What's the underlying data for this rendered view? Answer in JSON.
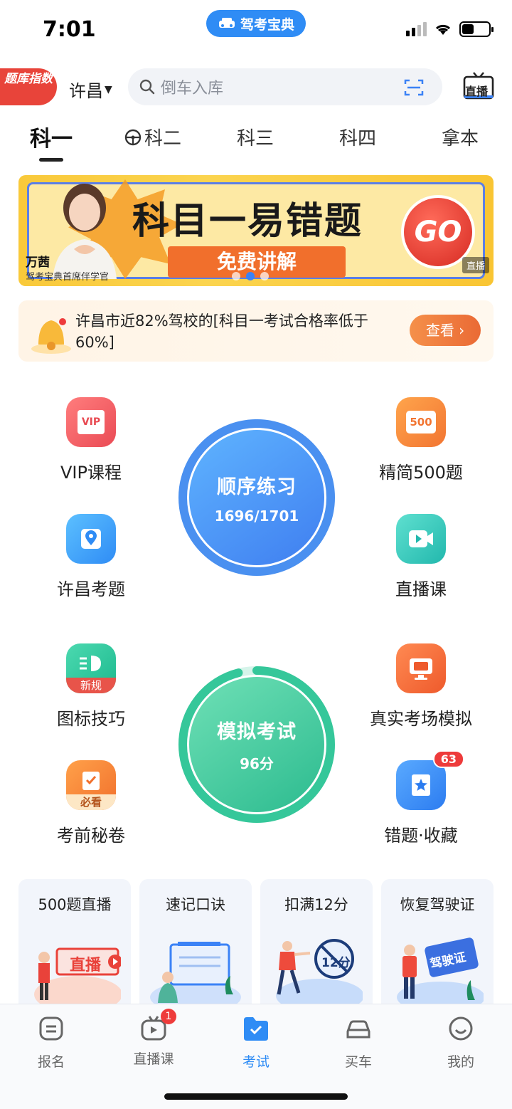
{
  "status_bar": {
    "time": "7:01",
    "app_name": "驾考宝典"
  },
  "header": {
    "index_badge": "题库指数",
    "city": "许昌",
    "search_placeholder": "倒车入库",
    "live_label": "直播"
  },
  "tabs": [
    {
      "label": "科一",
      "active": true
    },
    {
      "label": "科二",
      "active": false
    },
    {
      "label": "科三",
      "active": false
    },
    {
      "label": "科四",
      "active": false
    },
    {
      "label": "拿本",
      "active": false
    }
  ],
  "banner": {
    "title": "科目一易错题",
    "pill": "免费讲解",
    "go": "GO",
    "presenter_name": "万茜",
    "presenter_title": "驾考宝典首席伴学官",
    "tag": "直播",
    "active_dot": 2
  },
  "notice": {
    "text": "许昌市近82%驾校的[科目一考试合格率低于60%]",
    "button": "查看 ›"
  },
  "features": {
    "vip": "VIP课程",
    "jingjian": "精简500题",
    "xuchang": "许昌考题",
    "zhibo": "直播课",
    "tubiao": "图标技巧",
    "tubiao_badge": "新规",
    "zhenshi": "真实考场模拟",
    "miju": "考前秘卷",
    "miju_badge": "必看",
    "cuoti": "错题·收藏",
    "cuoti_count": "63",
    "vip_icon_text": "VIP",
    "jingjian_icon_text": "500"
  },
  "practice": {
    "title": "顺序练习",
    "progress_text": "1696/1701",
    "progress": 0.997
  },
  "exam": {
    "title": "模拟考试",
    "score_text": "96分",
    "score": 96
  },
  "cards": [
    {
      "title": "500题直播",
      "art_text": "直播"
    },
    {
      "title": "速记口诀",
      "art_text": ""
    },
    {
      "title": "扣满12分",
      "art_text": "12分"
    },
    {
      "title": "恢复驾驶证",
      "art_text": "驾驶证"
    }
  ],
  "tabbar": [
    {
      "label": "报名",
      "active": false
    },
    {
      "label": "直播课",
      "active": false,
      "badge": "1"
    },
    {
      "label": "考试",
      "active": true
    },
    {
      "label": "买车",
      "active": false
    },
    {
      "label": "我的",
      "active": false
    }
  ],
  "colors": {
    "accent": "#2f8cf5",
    "practice": "#4a90f0",
    "exam": "#35c79a",
    "badge": "#ee3b3b"
  }
}
